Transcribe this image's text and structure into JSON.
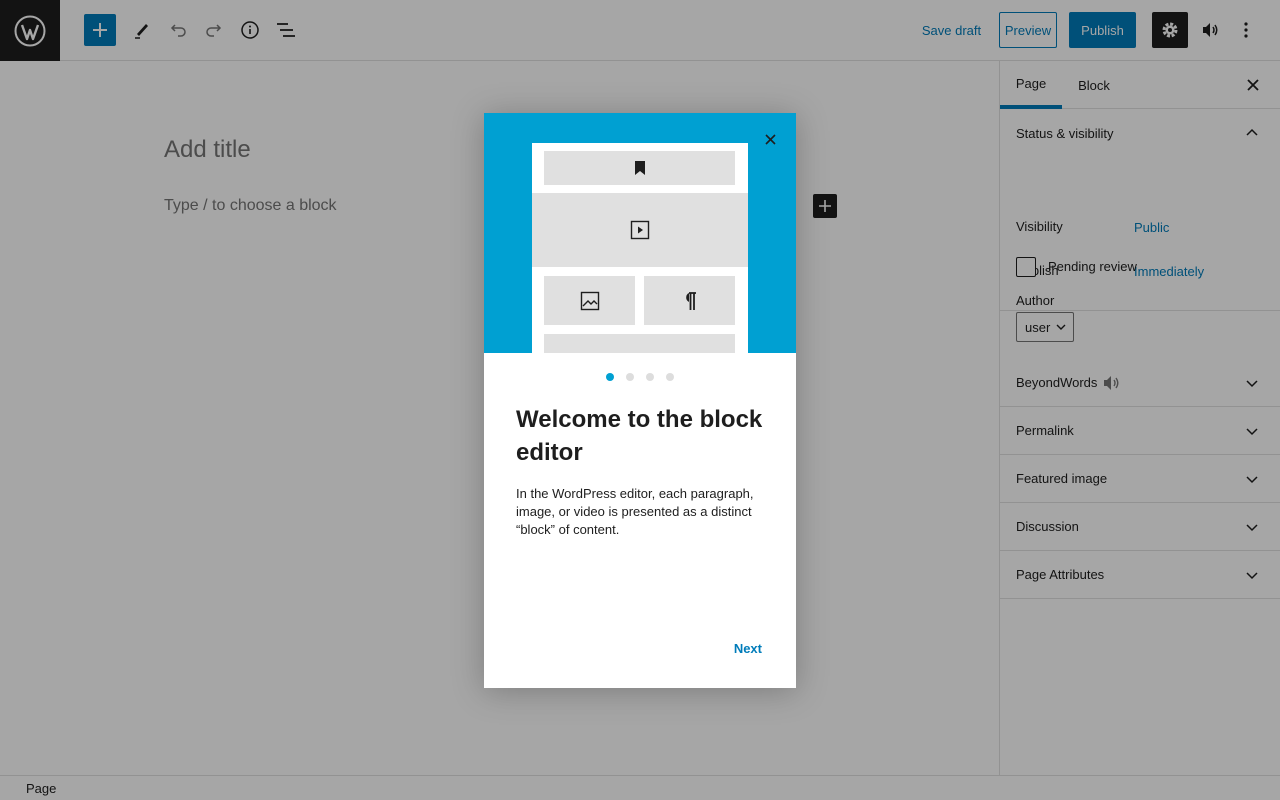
{
  "topbar": {
    "logo_icon": "wordpress-logo-icon",
    "add_icon": "plus-icon",
    "tools_icon": "pencil-icon",
    "undo_icon": "undo-icon",
    "redo_icon": "redo-icon",
    "details_icon": "info-icon",
    "outline_icon": "list-view-icon",
    "save_draft_label": "Save draft",
    "preview_label": "Preview",
    "publish_label": "Publish",
    "settings_icon": "gear-icon",
    "speaker_icon": "speaker-icon",
    "more_icon": "more-vertical-icon"
  },
  "editor": {
    "title_placeholder": "Add title",
    "block_placeholder": "Type / to choose a block"
  },
  "sidebar": {
    "tabs": [
      {
        "label": "Page",
        "active": true
      },
      {
        "label": "Block",
        "active": false
      }
    ],
    "status": {
      "heading": "Status & visibility",
      "visibility_label": "Visibility",
      "visibility_value": "Public",
      "publish_label": "Publish",
      "publish_value": "Immediately",
      "pending_label": "Pending review",
      "pending_checked": false,
      "author_label": "Author",
      "author_value": "user"
    },
    "panels": [
      {
        "label": "BeyondWords"
      },
      {
        "label": "Permalink"
      },
      {
        "label": "Featured image"
      },
      {
        "label": "Discussion"
      },
      {
        "label": "Page Attributes"
      }
    ]
  },
  "footer": {
    "breadcrumb": "Page"
  },
  "modal": {
    "heading": "Welcome to the block editor",
    "body": "In the WordPress editor, each paragraph, image, or video is presented as a distinct “block” of content.",
    "next_label": "Next",
    "page_count": 4,
    "current_page": 1,
    "hero_color": "#00a0d2"
  },
  "colors": {
    "accent": "#007cba",
    "dark": "#1e1e1e"
  }
}
